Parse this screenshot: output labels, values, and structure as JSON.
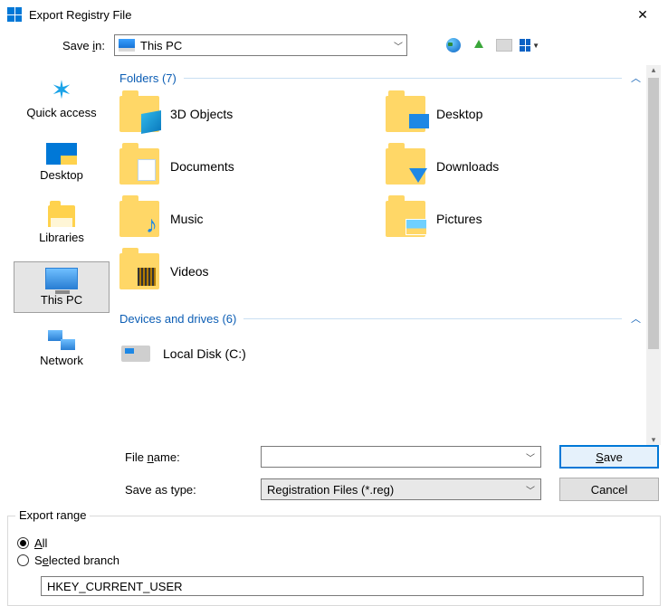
{
  "window": {
    "title": "Export Registry File"
  },
  "savein": {
    "label": "Save in:",
    "value": "This PC"
  },
  "places": {
    "quick_access": "Quick access",
    "desktop": "Desktop",
    "libraries": "Libraries",
    "this_pc": "This PC",
    "network": "Network"
  },
  "sections": {
    "folders_header": "Folders (7)",
    "drives_header": "Devices and drives (6)"
  },
  "folders": {
    "obj3d": "3D Objects",
    "desktop": "Desktop",
    "documents": "Documents",
    "downloads": "Downloads",
    "music": "Music",
    "pictures": "Pictures",
    "videos": "Videos"
  },
  "drives": {
    "local_c": "Local Disk (C:)"
  },
  "form": {
    "filename_label": "File name:",
    "filename_value": "",
    "type_label": "Save as type:",
    "type_value": "Registration Files (*.reg)",
    "save_btn": "Save",
    "cancel_btn": "Cancel"
  },
  "export": {
    "legend": "Export range",
    "all_label": "All",
    "selected_label": "Selected branch",
    "branch_value": "HKEY_CURRENT_USER"
  }
}
